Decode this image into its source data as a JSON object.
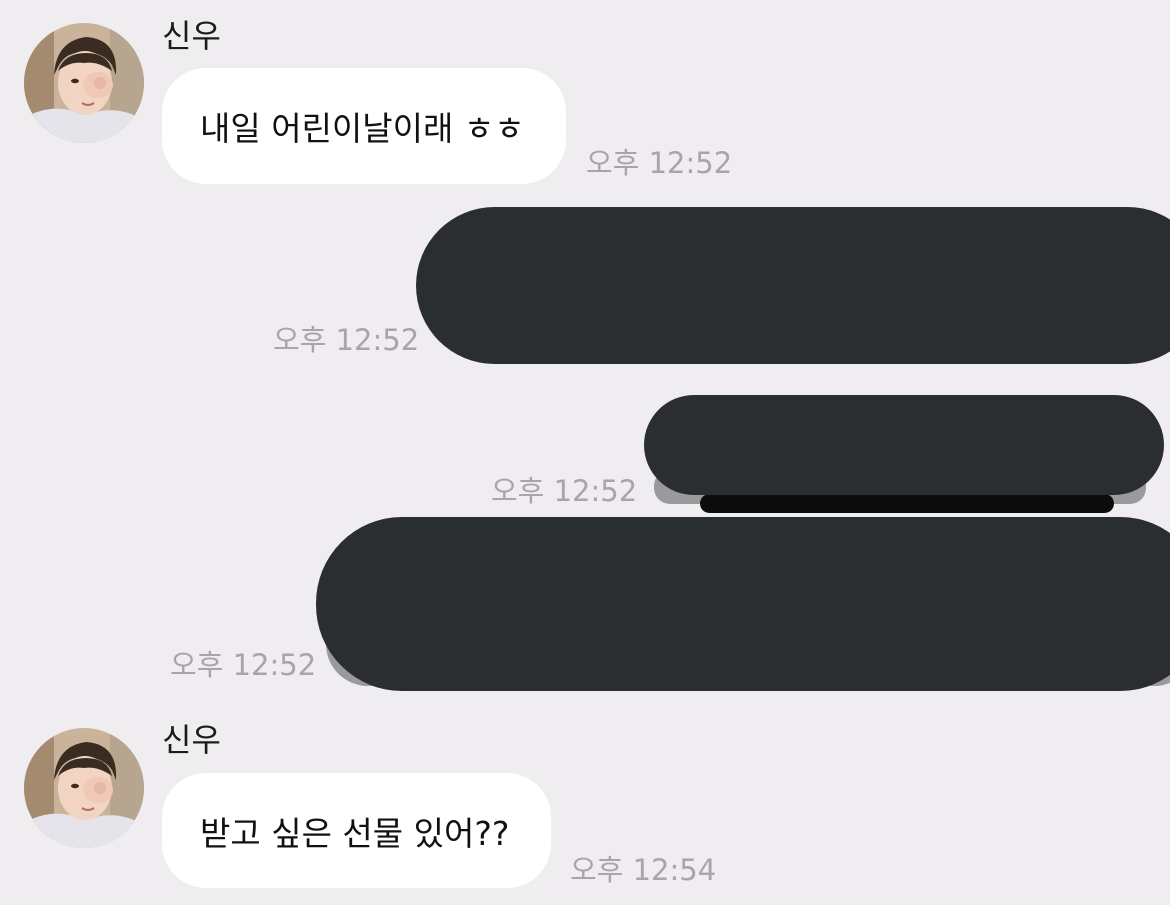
{
  "messages": [
    {
      "sender": "신우",
      "text": "내일 어린이날이래 ㅎㅎ",
      "time": "오후 12:52"
    },
    {
      "sender": "me",
      "redacted": true,
      "time": "오후 12:52"
    },
    {
      "sender": "me",
      "redacted": true,
      "time": "오후 12:52"
    },
    {
      "sender": "me",
      "redacted": true,
      "time": "오후 12:52"
    },
    {
      "sender": "신우",
      "text": "받고 싶은 선물 있어??",
      "time": "오후 12:54"
    }
  ],
  "colors": {
    "background": "#f0edf0",
    "incoming_bubble": "#ffffff",
    "redaction": "#2b2e31",
    "timestamp": "#a7a5a8"
  }
}
